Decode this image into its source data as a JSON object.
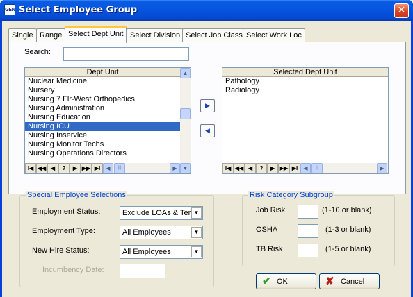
{
  "window": {
    "title": "Select Employee Group",
    "app_icon_text": "GEN",
    "close_glyph": "✕"
  },
  "tabs": [
    "Single",
    "Range",
    "Select Dept Unit",
    "Select Division",
    "Select Job Class",
    "Select Work Loc"
  ],
  "active_tab": "Select Dept Unit",
  "search": {
    "label": "Search:",
    "value": ""
  },
  "dept_list": {
    "header": "Dept Unit",
    "items": [
      "Nuclear Medicine",
      "Nursery",
      "Nursing 7 Flr-West Orthopedics",
      "Nursing Administration",
      "Nursing Education",
      "Nursing ICU",
      "Nursing Inservice",
      "Nursing Monitor Techs",
      "Nursing Operations Directors"
    ],
    "selected": "Nursing ICU"
  },
  "selected_list": {
    "header": "Selected Dept Unit",
    "items": [
      "Pathology",
      "Radiology"
    ]
  },
  "move_buttons": {
    "add_glyph": "▶",
    "remove_glyph": "◀"
  },
  "nav_glyphs": [
    "I◀",
    "◀◀",
    "◀",
    "?",
    "▶",
    "▶▶",
    "▶I"
  ],
  "scroll_glyphs": {
    "up": "▲",
    "down": "▼",
    "left": "◀",
    "right": "▶",
    "grip": "|||"
  },
  "special": {
    "title": "Special Employee Selections",
    "employment_status": {
      "label": "Employment Status:",
      "value": "Exclude LOAs & Term"
    },
    "employment_type": {
      "label": "Employment Type:",
      "value": "All Employees"
    },
    "new_hire_status": {
      "label": "New Hire Status:",
      "value": "All Employees"
    },
    "incumbency_date": {
      "label": "Incumbency Date:",
      "value": ""
    },
    "dropdown_glyph": "▼"
  },
  "risk": {
    "title": "Risk Category Subgroup",
    "job_risk": {
      "label": "Job Risk",
      "hint": "(1-10 or blank)",
      "value": ""
    },
    "osha": {
      "label": "OSHA",
      "hint": "(1-3 or blank)",
      "value": ""
    },
    "tb_risk": {
      "label": "TB Risk",
      "hint": "(1-5 or blank)",
      "value": ""
    }
  },
  "buttons": {
    "ok": {
      "label": "OK",
      "icon": "✔",
      "icon_color": "#2e9a2e"
    },
    "cancel": {
      "label": "Cancel",
      "icon": "✘",
      "icon_color": "#b02018"
    }
  }
}
